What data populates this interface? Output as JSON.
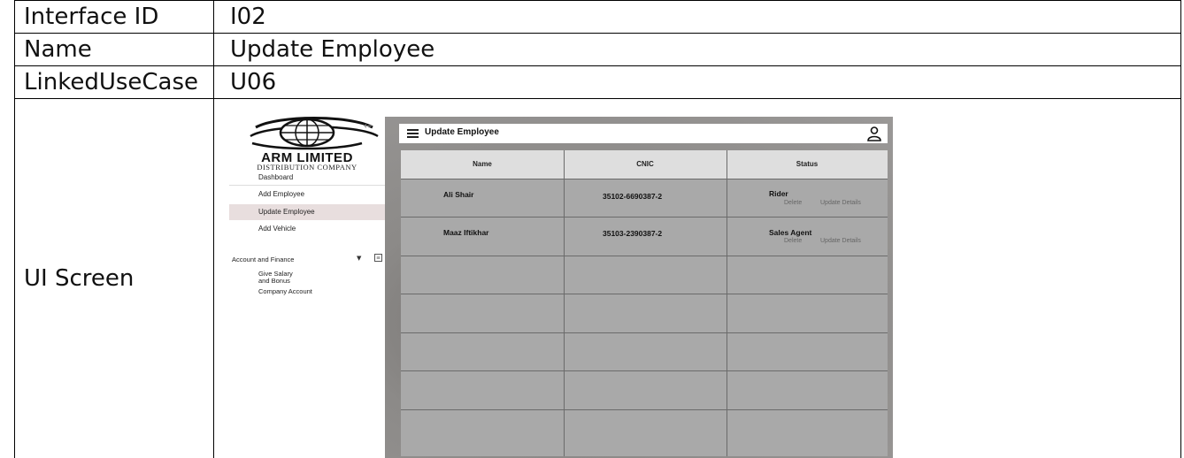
{
  "doc": {
    "rows": [
      {
        "label": "Interface ID",
        "value": "I02"
      },
      {
        "label": "Name",
        "value": "Update Employee"
      },
      {
        "label": "LinkedUseCase",
        "value": "U06"
      },
      {
        "label": "UI Screen"
      }
    ]
  },
  "screen": {
    "brand": {
      "name": "ARM LIMITED",
      "tagline": "DISTRIBUTION COMPANY"
    },
    "sidebar": {
      "back_icon": "arrow-left-icon",
      "items": [
        "Dashboard",
        "Add Employee",
        "Update Employee",
        "Add Vehicle"
      ],
      "active": "Update Employee",
      "group": {
        "label": "Account and Finance",
        "children": [
          "Give Salary and Bonus",
          "Company Account"
        ]
      }
    },
    "topbar": {
      "title": "Update Employee",
      "menu_icon": "hamburger-icon",
      "user_icon": "user-icon"
    },
    "table": {
      "columns": [
        "Name",
        "CNIC",
        "Status"
      ],
      "rows": [
        {
          "name": "Ali Shair",
          "cnic": "35102-6690387-2",
          "status": "Rider",
          "delete": "Delete",
          "update": "Update Details"
        },
        {
          "name": "Maaz Iftikhar",
          "cnic": "35103-2390387-2",
          "status": "Sales Agent",
          "delete": "Delete",
          "update": "Update Details"
        }
      ]
    }
  }
}
